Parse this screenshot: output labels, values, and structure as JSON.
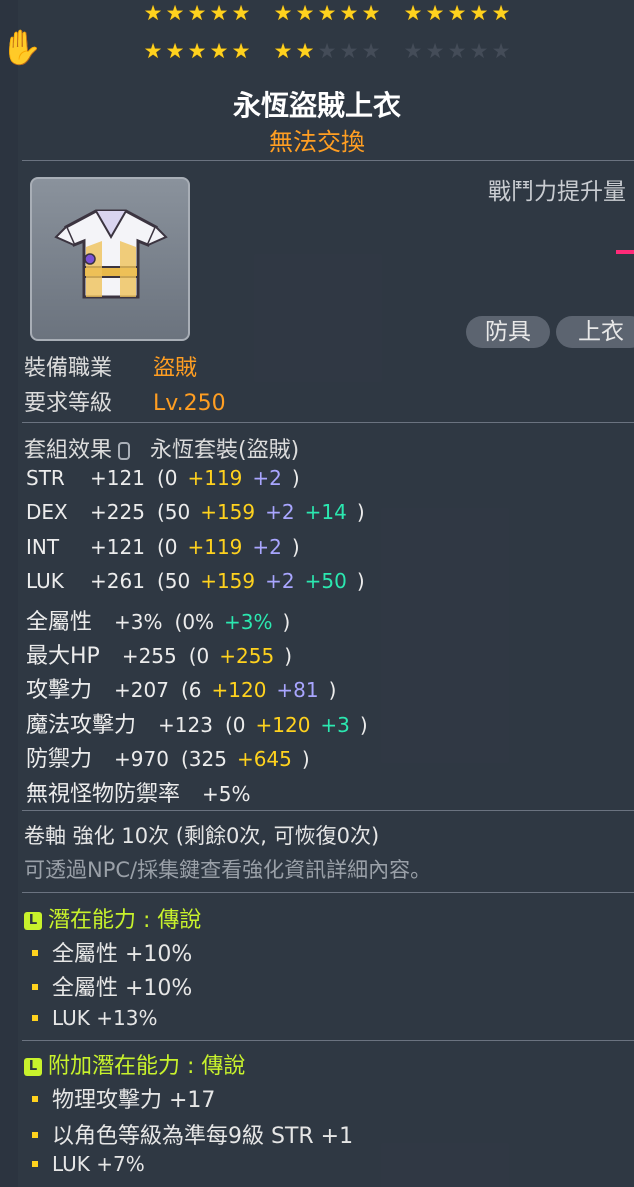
{
  "stars": {
    "row1": [
      5,
      5,
      5
    ],
    "row2": [
      5,
      2,
      0
    ],
    "per_group": 5
  },
  "item": {
    "name": "永恆盜賊上衣",
    "trade": "無法交換",
    "combat_power_label": "戰鬥力提升量",
    "tags": [
      "防具",
      "上衣"
    ]
  },
  "req": {
    "job_label": "裝備職業",
    "job_value": "盜賊",
    "level_label": "要求等級",
    "level_value": "Lv.250"
  },
  "set": {
    "label": "套組效果",
    "value": "永恆套裝(盜賊)"
  },
  "stats": [
    {
      "name": "STR",
      "total": "+121",
      "parts": [
        [
          "(0",
          "w"
        ],
        [
          "+119",
          "y"
        ],
        [
          "+2",
          "p"
        ]
      ],
      "close": ")"
    },
    {
      "name": "DEX",
      "total": "+225",
      "parts": [
        [
          "(50",
          "w"
        ],
        [
          "+159",
          "y"
        ],
        [
          "+2",
          "p"
        ],
        [
          "+14",
          "g"
        ]
      ],
      "close": ")"
    },
    {
      "name": "INT",
      "total": "+121",
      "parts": [
        [
          "(0",
          "w"
        ],
        [
          "+119",
          "y"
        ],
        [
          "+2",
          "p"
        ]
      ],
      "close": ")"
    },
    {
      "name": "LUK",
      "total": "+261",
      "parts": [
        [
          "(50",
          "w"
        ],
        [
          "+159",
          "y"
        ],
        [
          "+2",
          "p"
        ],
        [
          "+50",
          "g"
        ]
      ],
      "close": ")"
    },
    {
      "name": "全屬性",
      "total": "+3%",
      "parts": [
        [
          "(0%",
          "w"
        ],
        [
          "+3%",
          "g"
        ]
      ],
      "close": ")"
    },
    {
      "name": "最大HP",
      "total": "+255",
      "parts": [
        [
          "(0",
          "w"
        ],
        [
          "+255",
          "y"
        ]
      ],
      "close": ")"
    },
    {
      "name": "攻擊力",
      "total": "+207",
      "parts": [
        [
          "(6",
          "w"
        ],
        [
          "+120",
          "y"
        ],
        [
          "+81",
          "p"
        ]
      ],
      "close": ")"
    },
    {
      "name": "魔法攻擊力",
      "total": "+123",
      "parts": [
        [
          "(0",
          "w"
        ],
        [
          "+120",
          "y"
        ],
        [
          "+3",
          "g"
        ]
      ],
      "close": ")"
    },
    {
      "name": "防禦力",
      "total": "+970",
      "parts": [
        [
          "(325",
          "w"
        ],
        [
          "+645",
          "y"
        ]
      ],
      "close": ")"
    },
    {
      "name": "無視怪物防禦率",
      "total": "+5%",
      "parts": [],
      "close": ""
    }
  ],
  "scroll": {
    "line": "卷軸 強化 10次 (剩餘0次, 可恢復0次)",
    "hint": "可透過NPC/採集鍵查看強化資訊詳細內容。"
  },
  "potential": {
    "title": "潛在能力 : 傳說",
    "icon": "L",
    "lines": [
      "全屬性 +10%",
      "全屬性 +10%",
      "LUK +13%"
    ]
  },
  "bonus_potential": {
    "title": "附加潛在能力 : 傳說",
    "icon": "L",
    "lines": [
      "物理攻擊力 +17",
      "以角色等級為準每9級 STR +1",
      "LUK +7%"
    ]
  },
  "colors": {
    "star_on": "#ffd21e",
    "star_off": "#444c58",
    "orange": "#ff9e22",
    "legendary": "#c8f22c",
    "bonus_flame": "#2be8b0",
    "star_force": "#ffd21e",
    "scroll_bonus": "#a9a6ff"
  }
}
